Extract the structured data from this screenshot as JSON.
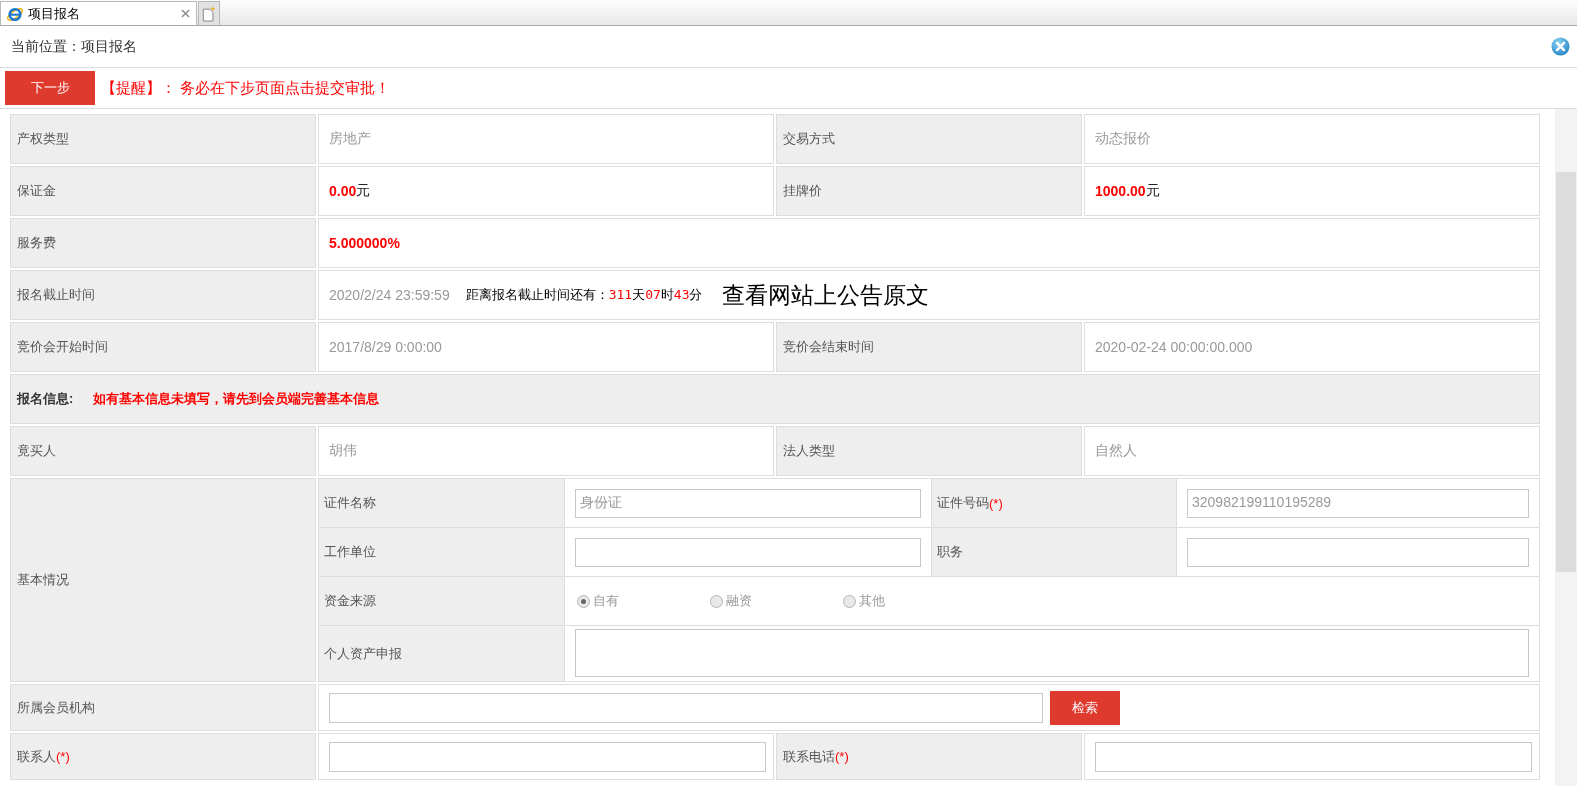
{
  "browser": {
    "tab": {
      "title": "项目报名",
      "selected": true
    }
  },
  "breadcrumb": "当前位置：项目报名",
  "toolbar": {
    "next_button": "下一步",
    "reminder": "【提醒】： 务必在下步页面点击提交审批！"
  },
  "rows": [
    {
      "kind": "pair",
      "fields": [
        {
          "label": "产权类型",
          "kind": "text",
          "value": "房地产"
        },
        {
          "label": "交易方式",
          "kind": "text",
          "value": "动态报价"
        }
      ]
    },
    {
      "kind": "pair",
      "fields": [
        {
          "label": "保证金",
          "kind": "amount",
          "value": "0.00",
          "unit": "元"
        },
        {
          "label": "挂牌价",
          "kind": "amount",
          "value": "1000.00",
          "unit": "元"
        }
      ]
    },
    {
      "kind": "wide",
      "fields": [
        {
          "label": "服务费",
          "kind": "amount",
          "value": "5.000000%"
        }
      ]
    },
    {
      "kind": "deadline",
      "label": "报名截止时间",
      "value": "2020/2/24 23:59:59",
      "countdown": {
        "prefix": "距离报名截止时间还有：",
        "parts": [
          {
            "number": "311",
            "unit": "天"
          },
          {
            "number": "07",
            "unit": "时"
          },
          {
            "number": "43",
            "unit": "分"
          }
        ]
      },
      "link": "查看网站上公告原文"
    },
    {
      "kind": "pair",
      "fields": [
        {
          "label": "竞价会开始时间",
          "kind": "text",
          "value": "2017/8/29 0:00:00"
        },
        {
          "label": "竞价会结束时间",
          "kind": "text",
          "value": "2020-02-24 00:00:00.000"
        }
      ]
    },
    {
      "kind": "section",
      "title": "报名信息:",
      "note": "如有基本信息未填写，请先到会员端完善基本信息"
    },
    {
      "kind": "pair",
      "fields": [
        {
          "label": "竟买人",
          "kind": "text",
          "value": "胡伟"
        },
        {
          "label": "法人类型",
          "kind": "text",
          "value": "自然人"
        }
      ]
    },
    {
      "kind": "group",
      "label": "基本情况",
      "rows": [
        {
          "kind": "inputs",
          "fields": [
            {
              "label": "证件名称",
              "value": "身份证"
            },
            {
              "label": "证件号码",
              "required_mark": "(*)",
              "value": "320982199110195289"
            }
          ]
        },
        {
          "kind": "inputs",
          "fields": [
            {
              "label": "工作单位"
            },
            {
              "label": "职务"
            }
          ]
        },
        {
          "kind": "radio",
          "label": "资金来源",
          "options": [
            {
              "label": "自有",
              "selected": true,
              "disabled": true
            },
            {
              "label": "融资",
              "selected": false,
              "disabled": true
            },
            {
              "label": "其他",
              "selected": false,
              "disabled": true
            }
          ]
        },
        {
          "kind": "textarea",
          "label": "个人资产申报"
        }
      ]
    },
    {
      "kind": "search",
      "label": "所属会员机构",
      "button": "检索"
    },
    {
      "kind": "pair_inputs",
      "fields": [
        {
          "label": "联系人",
          "required_mark": "(*)"
        },
        {
          "label": "联系电话",
          "required_mark": "(*)"
        }
      ]
    }
  ]
}
